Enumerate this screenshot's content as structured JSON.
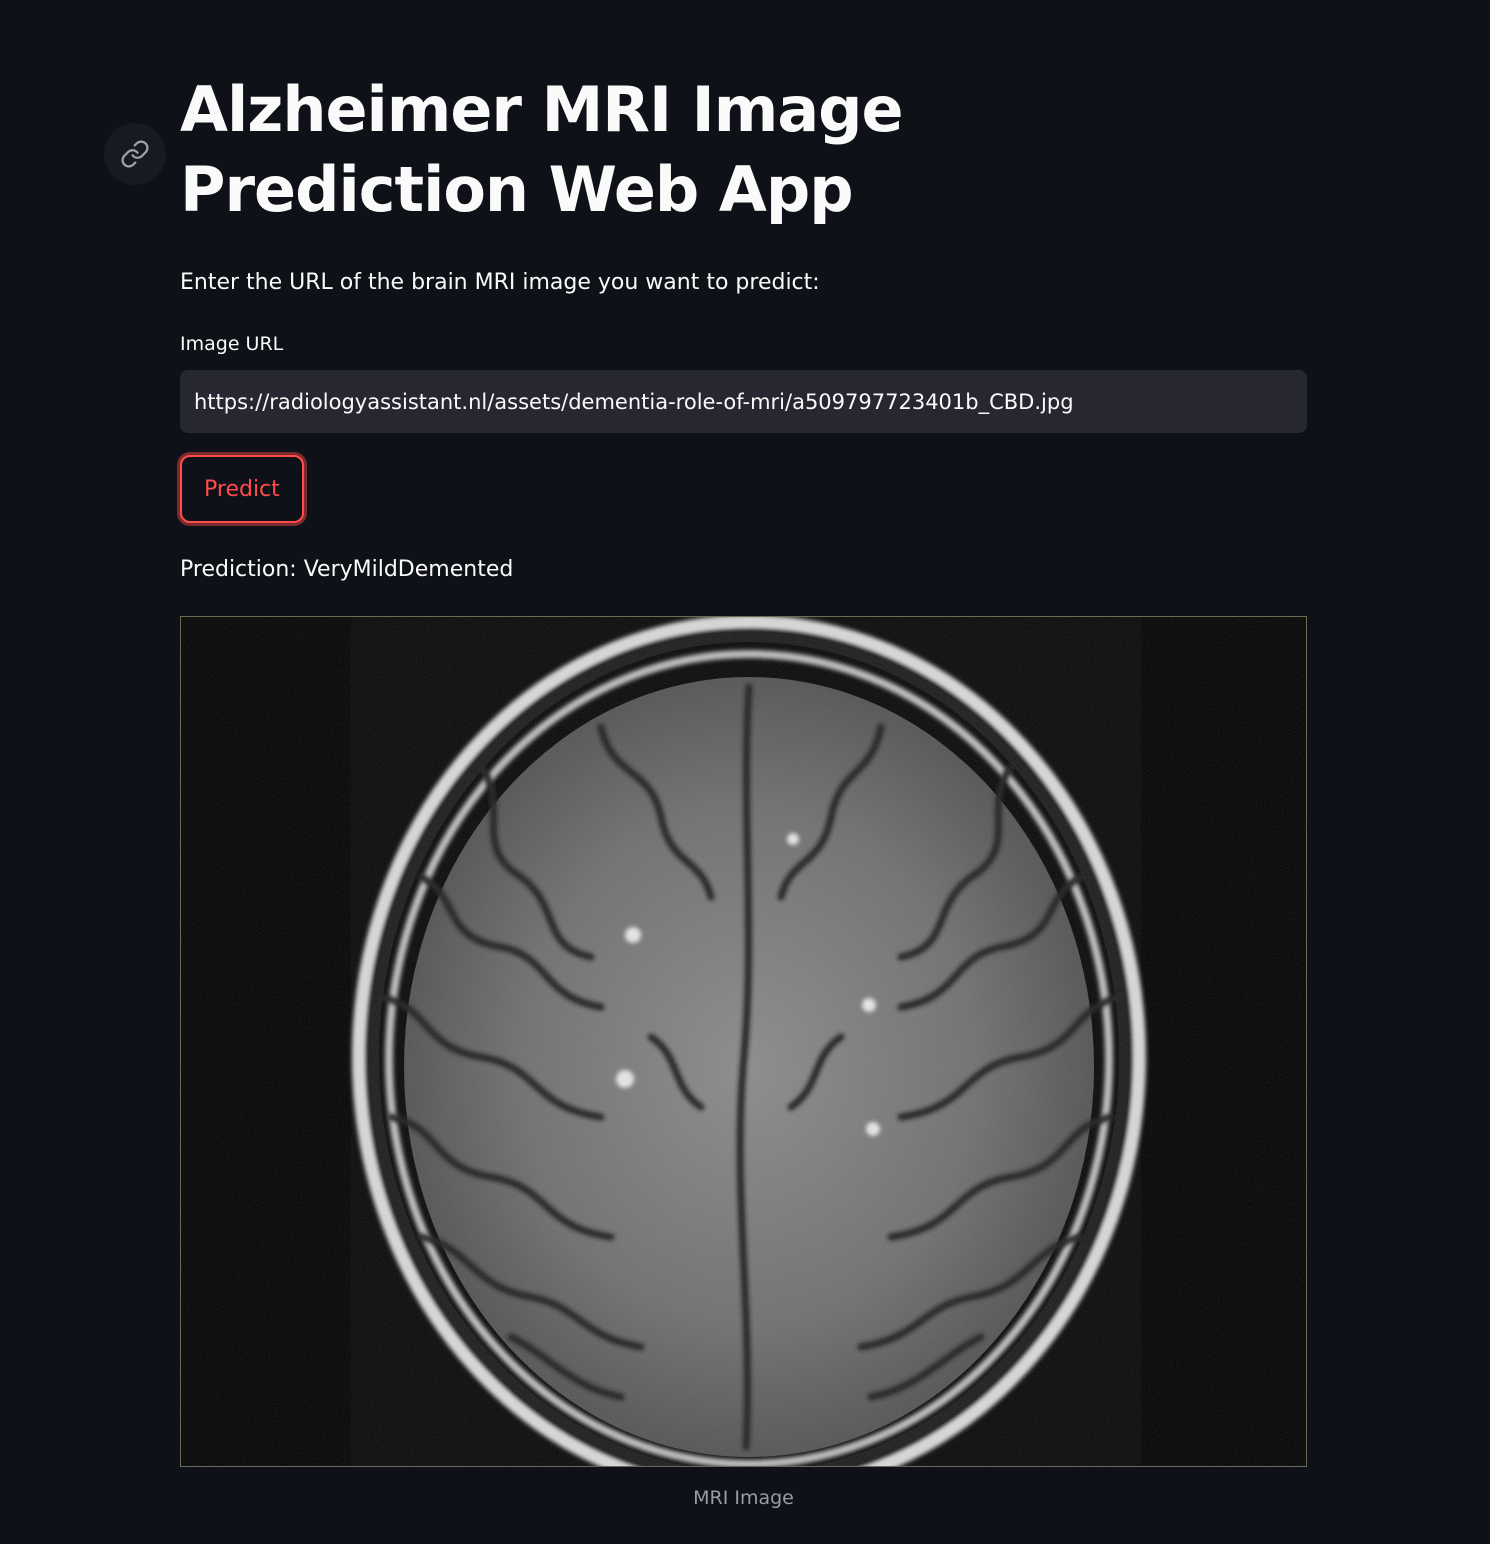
{
  "header": {
    "title": "Alzheimer MRI Image Prediction Web App",
    "anchor_icon": "link-icon"
  },
  "form": {
    "intro_text": "Enter the URL of the brain MRI image you want to predict:",
    "url_label": "Image URL",
    "url_value": "https://radiologyassistant.nl/assets/dementia-role-of-mri/a509797723401b_CBD.jpg",
    "predict_label": "Predict"
  },
  "result": {
    "prediction_text": "Prediction: VeryMildDemented",
    "image_caption": "MRI Image"
  },
  "colors": {
    "background": "#0e1117",
    "input_background": "#262730",
    "accent": "#ff4b4b",
    "text": "#fafafa",
    "caption": "#9a9ca3"
  }
}
